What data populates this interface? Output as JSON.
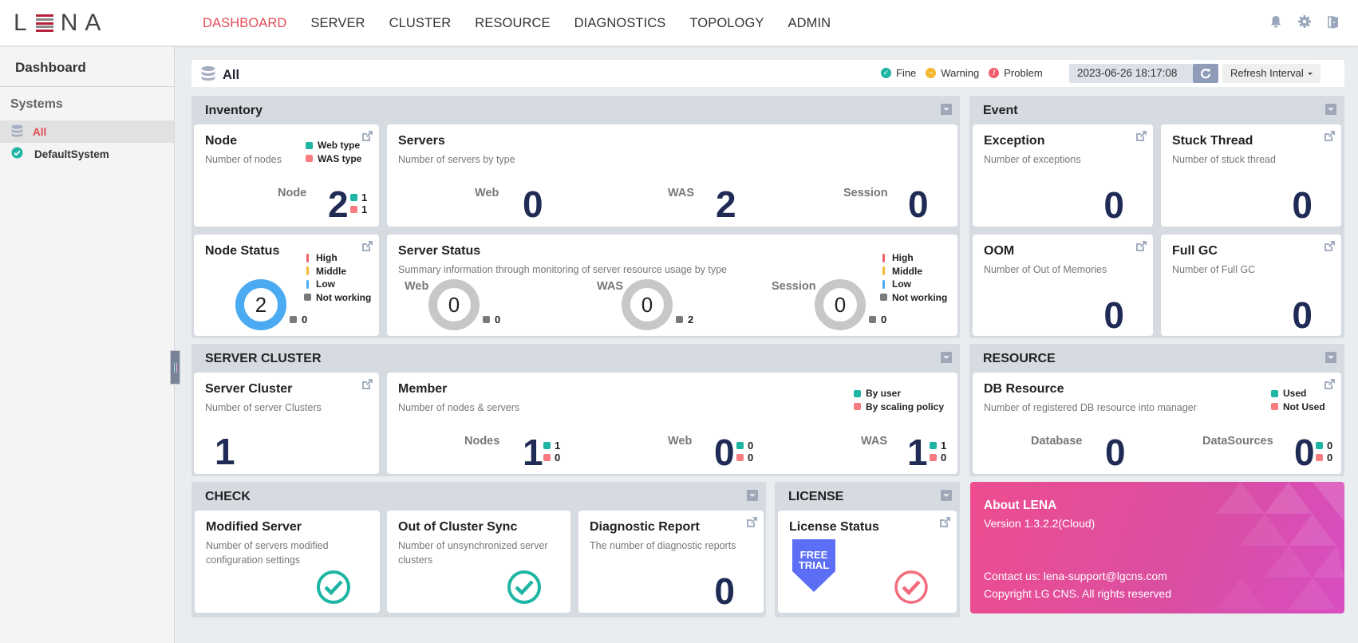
{
  "app": {
    "logo": "LENA"
  },
  "nav": {
    "items": [
      {
        "label": "DASHBOARD",
        "active": true
      },
      {
        "label": "SERVER"
      },
      {
        "label": "CLUSTER"
      },
      {
        "label": "RESOURCE"
      },
      {
        "label": "DIAGNOSTICS"
      },
      {
        "label": "TOPOLOGY"
      },
      {
        "label": "ADMIN"
      }
    ]
  },
  "top_icons": [
    "bell-icon",
    "gear-icon",
    "logout-icon"
  ],
  "sidebar": {
    "title": "Dashboard",
    "section": "Systems",
    "items": [
      {
        "label": "All",
        "icon": "database-icon",
        "active": true
      },
      {
        "label": "DefaultSystem",
        "icon": "check-circle-icon",
        "status": "fine"
      }
    ]
  },
  "filterbar": {
    "title": "All",
    "legend": [
      {
        "label": "Fine",
        "color": "#1fb5a3"
      },
      {
        "label": "Warning",
        "color": "#f5b82e"
      },
      {
        "label": "Problem",
        "color": "#ef5f6e"
      }
    ],
    "datetime": "2023-06-26 18:17:08",
    "refresh_interval_label": "Refresh Interval"
  },
  "colors": {
    "web": "#1fb5a3",
    "was": "#f87b80",
    "high": "#ef5f6e",
    "middle": "#f5b82e",
    "low": "#4aaaf2",
    "not_working": "#7a7a7a",
    "number": "#1f2b55"
  },
  "inventory": {
    "title": "Inventory",
    "node": {
      "title": "Node",
      "sub": "Number of nodes",
      "legend": [
        "Web type",
        "WAS type"
      ],
      "label": "Node",
      "total": "2",
      "web": "1",
      "was": "1"
    },
    "servers": {
      "title": "Servers",
      "sub": "Number of servers by type",
      "items": [
        {
          "label": "Web",
          "value": "0"
        },
        {
          "label": "WAS",
          "value": "2"
        },
        {
          "label": "Session",
          "value": "0"
        }
      ]
    },
    "node_status": {
      "title": "Node Status",
      "legend": [
        "High",
        "Middle",
        "Low",
        "Not working"
      ],
      "total": "2",
      "not_working": "0"
    },
    "server_status": {
      "title": "Server Status",
      "sub": "Summary information through monitoring of server resource usage by type",
      "legend": [
        "High",
        "Middle",
        "Low",
        "Not working"
      ],
      "items": [
        {
          "label": "Web",
          "total": "0",
          "not_working": "0"
        },
        {
          "label": "WAS",
          "total": "0",
          "not_working": "2"
        },
        {
          "label": "Session",
          "total": "0",
          "not_working": "0"
        }
      ]
    }
  },
  "event": {
    "title": "Event",
    "cards": [
      {
        "title": "Exception",
        "sub": "Number of exceptions",
        "value": "0"
      },
      {
        "title": "Stuck Thread",
        "sub": "Number of stuck thread",
        "value": "0"
      },
      {
        "title": "OOM",
        "sub": "Number of Out of Memories",
        "value": "0"
      },
      {
        "title": "Full GC",
        "sub": "Number of Full GC",
        "value": "0"
      }
    ]
  },
  "server_cluster": {
    "title": "SERVER CLUSTER",
    "cluster": {
      "title": "Server Cluster",
      "sub": "Number of server Clusters",
      "value": "1"
    },
    "member": {
      "title": "Member",
      "sub": "Number of nodes & servers",
      "legend": [
        "By user",
        "By scaling policy"
      ],
      "items": [
        {
          "label": "Nodes",
          "total": "1",
          "a": "1",
          "b": "0"
        },
        {
          "label": "Web",
          "total": "0",
          "a": "0",
          "b": "0"
        },
        {
          "label": "WAS",
          "total": "1",
          "a": "1",
          "b": "0"
        }
      ]
    }
  },
  "resource": {
    "title": "RESOURCE",
    "db": {
      "title": "DB Resource",
      "sub": "Number of registered DB resource into manager",
      "legend": [
        "Used",
        "Not Used"
      ],
      "database_label": "Database",
      "database": "0",
      "datasources_label": "DataSources",
      "datasources": "0",
      "used": "0",
      "not_used": "0"
    }
  },
  "check": {
    "title": "CHECK",
    "cards": [
      {
        "title": "Modified Server",
        "sub": "Number of servers modified configuration settings",
        "status": "ok"
      },
      {
        "title": "Out of Cluster Sync",
        "sub": "Number of unsynchronized server clusters",
        "status": "ok"
      },
      {
        "title": "Diagnostic Report",
        "sub": "The number of diagnostic reports",
        "value": "0"
      }
    ]
  },
  "license": {
    "title": "LICENSE",
    "card_title": "License Status",
    "badge_line1": "FREE",
    "badge_line2": "TRIAL"
  },
  "about": {
    "title": "About LENA",
    "version": "Version 1.3.2.2(Cloud)",
    "contact": "Contact us: lena-support@lgcns.com",
    "copyright": "Copyright LG CNS. All rights reserved"
  }
}
